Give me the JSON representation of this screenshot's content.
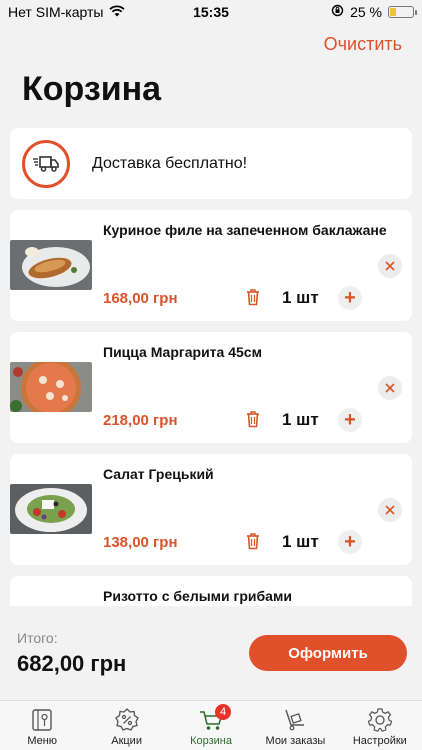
{
  "status_bar": {
    "carrier": "Нет SIM-карты",
    "time": "15:35",
    "battery": "25 %",
    "battery_level": 0.25
  },
  "header": {
    "clear_label": "Очистить",
    "title": "Корзина"
  },
  "delivery": {
    "text": "Доставка бесплатно!",
    "icon": "delivery-truck-icon"
  },
  "cart_items": [
    {
      "name": "Куриное филе на запеченном баклажане",
      "price": "168,00 грн",
      "quantity": "1 шт"
    },
    {
      "name": "Пицца Маргарита 45см",
      "price": "218,00 грн",
      "quantity": "1 шт"
    },
    {
      "name": "Салат Грецький",
      "price": "138,00 грн",
      "quantity": "1 шт"
    },
    {
      "name": "Ризотто с белыми грибами",
      "price": "",
      "quantity": ""
    }
  ],
  "item_buttons": {
    "plus": "+"
  },
  "footer": {
    "total_label": "Итого:",
    "total_value": "682,00 грн",
    "checkout_label": "Оформить"
  },
  "tabs": [
    {
      "label": "Меню",
      "icon": "menu-book-icon"
    },
    {
      "label": "Акции",
      "icon": "discount-icon"
    },
    {
      "label": "Корзина",
      "icon": "cart-icon",
      "badge": "4",
      "active": true
    },
    {
      "label": "Мои заказы",
      "icon": "orders-trolley-icon"
    },
    {
      "label": "Настройки",
      "icon": "gear-icon"
    }
  ],
  "colors": {
    "accent": "#e0502a",
    "price": "#d8542c",
    "active_tab": "#2c6b2f",
    "badge": "#e5332a"
  }
}
